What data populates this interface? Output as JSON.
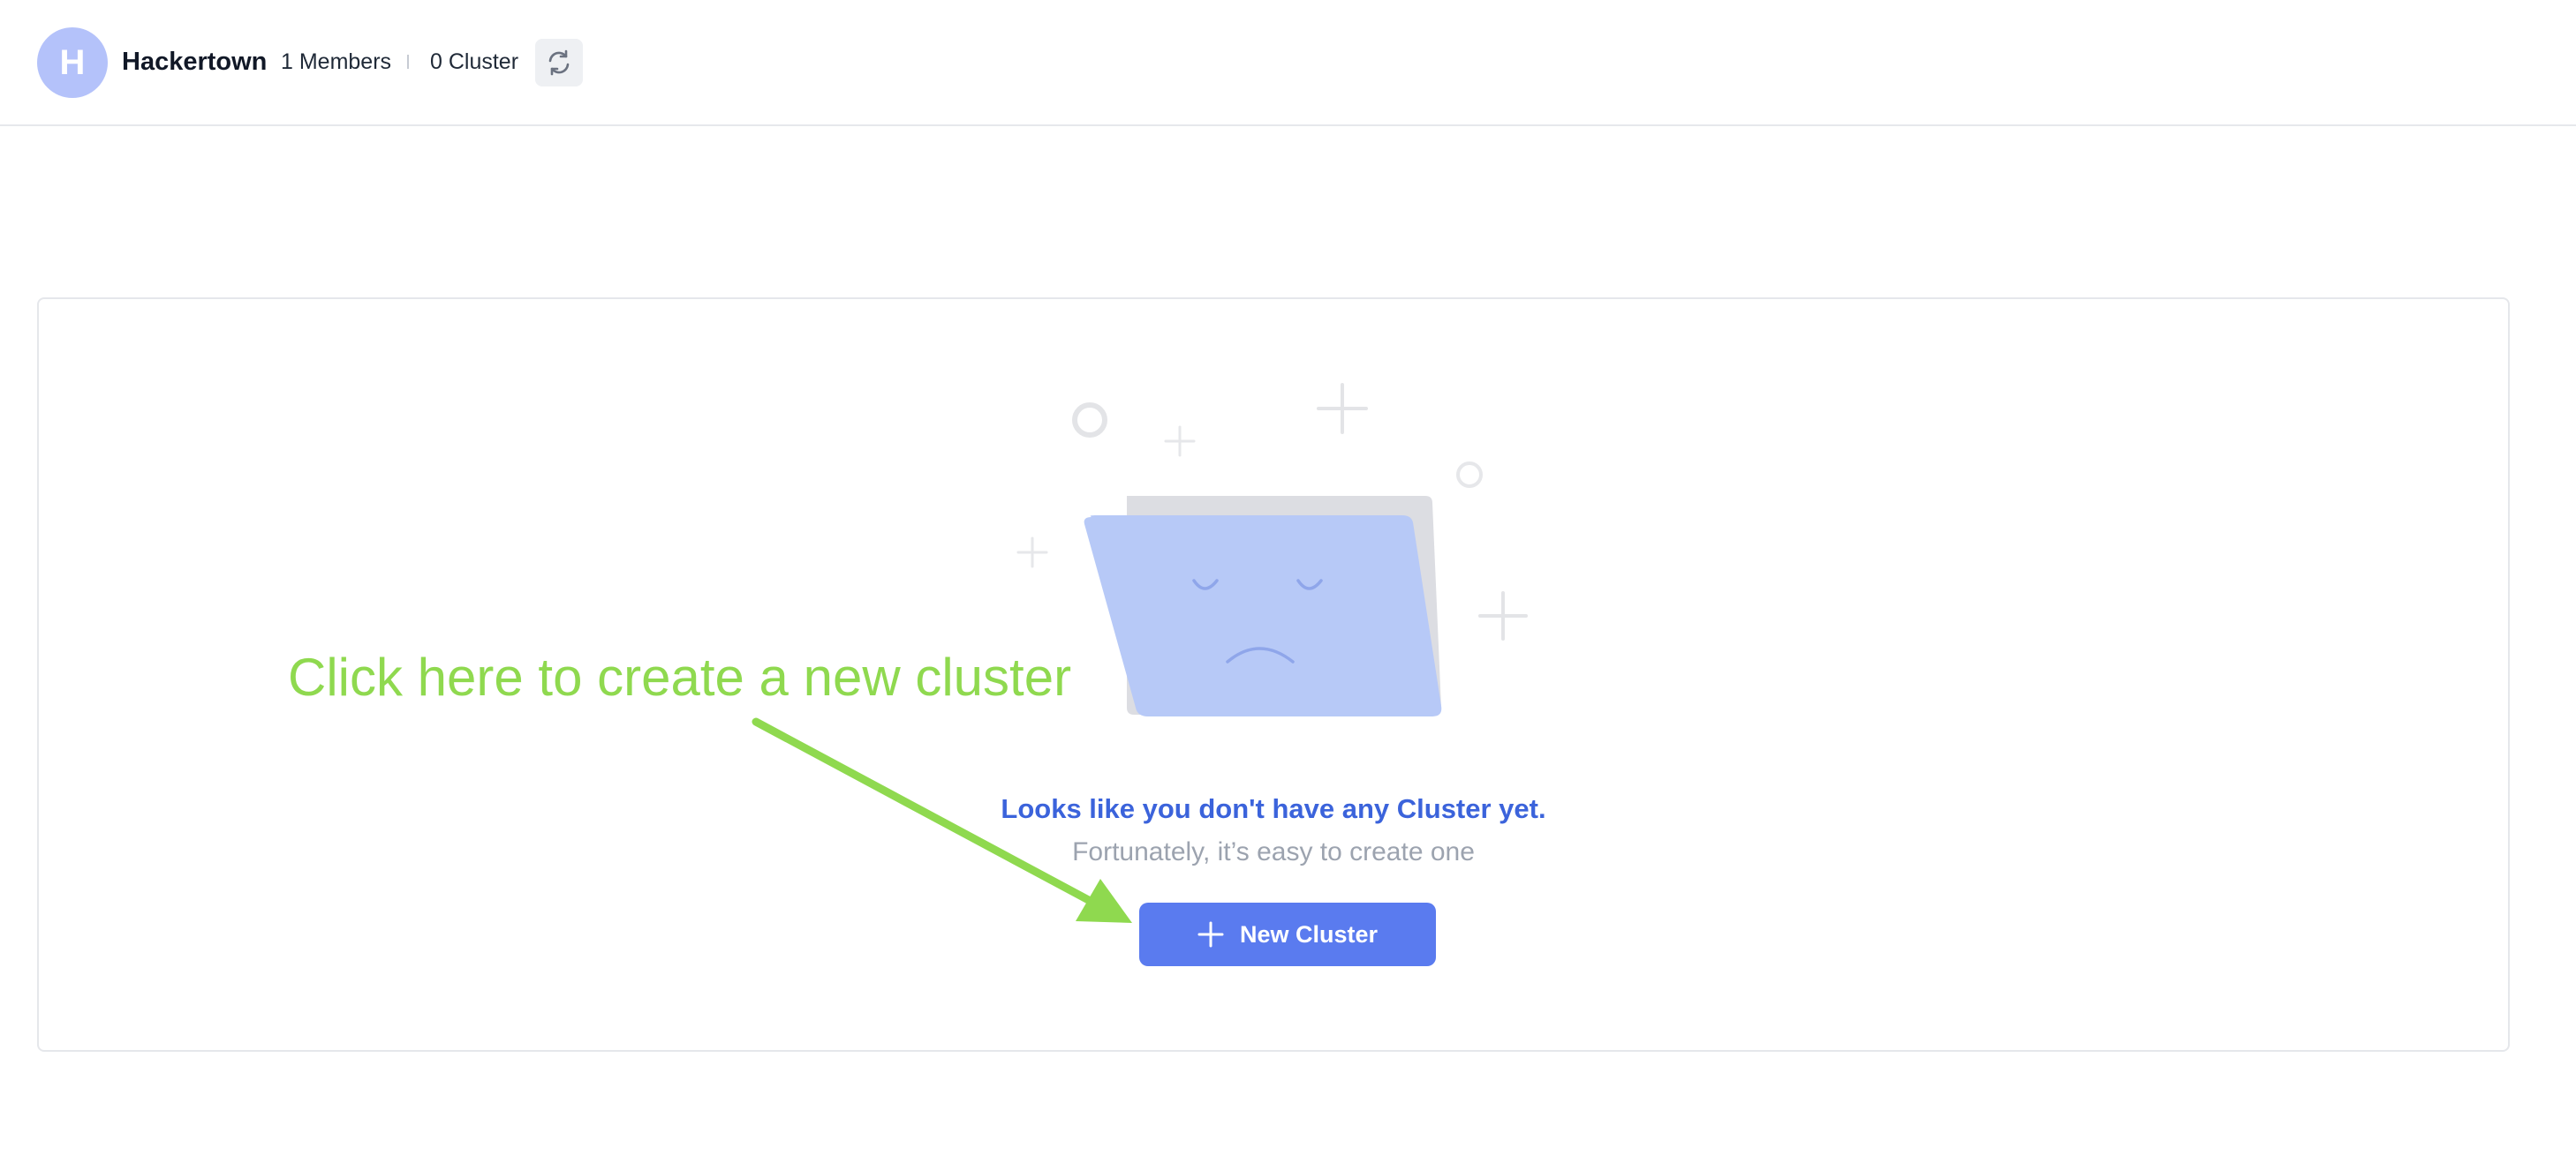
{
  "header": {
    "avatar_letter": "H",
    "org_name": "Hackertown",
    "members": "1 Members",
    "clusters": "0 Cluster"
  },
  "annotation": {
    "text": "Click here to create a new cluster"
  },
  "empty_state": {
    "title": "Looks like you don't have any Cluster yet.",
    "subtitle": "Fortunately, it’s easy to create one",
    "button_label": "New Cluster"
  },
  "colors": {
    "accent": "#5a7bef",
    "title_blue": "#3b63db",
    "annotation_green": "#8fd94f",
    "avatar_bg": "#b4c2fa"
  },
  "icons": {
    "refresh": "refresh-icon",
    "plus": "plus-icon",
    "illustration": "sad-folder-illustration"
  }
}
